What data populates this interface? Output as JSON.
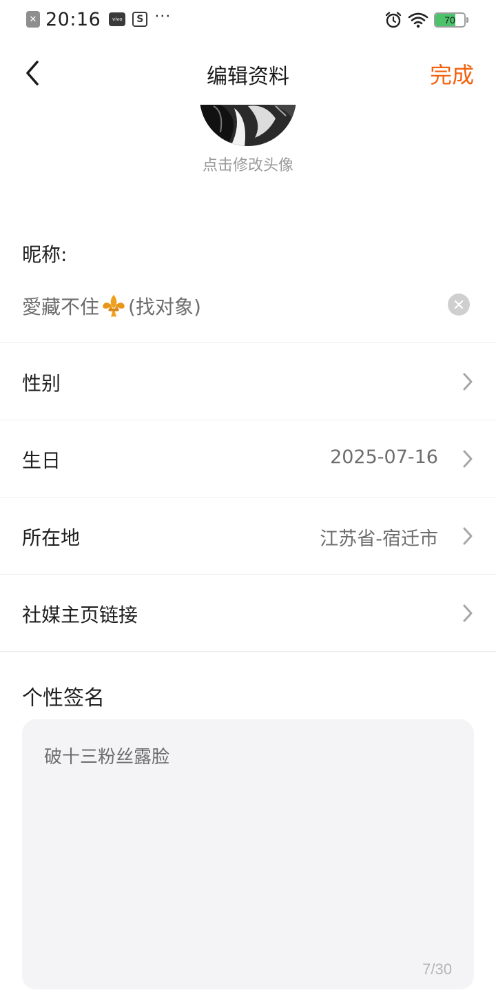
{
  "status_bar": {
    "time": "20:16",
    "vivo_label": "vivo",
    "s_label": "S",
    "dots": "···",
    "battery_level": "70",
    "battery_color": "#4cc36b"
  },
  "header": {
    "title": "编辑资料",
    "done_label": "完成",
    "accent_color": "#f2620e"
  },
  "avatar": {
    "hint": "点击修改头像"
  },
  "nickname": {
    "label": "昵称:",
    "value_prefix": "愛藏不住",
    "value_suffix": "(找对象)"
  },
  "rows": [
    {
      "label": "性别",
      "value": ""
    },
    {
      "label": "生日",
      "value": "2025-07-16"
    },
    {
      "label": "所在地",
      "value": "江苏省-宿迁市"
    },
    {
      "label": "社媒主页链接",
      "value": ""
    }
  ],
  "signature": {
    "label": "个性签名",
    "value": "破十三粉丝露脸",
    "count": "7/30"
  }
}
